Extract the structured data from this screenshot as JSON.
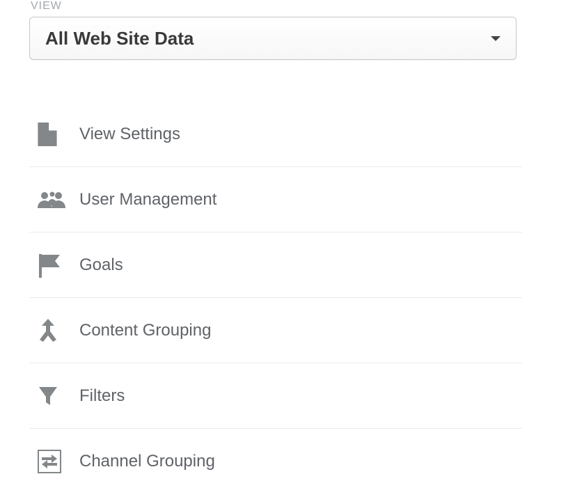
{
  "section_label": "VIEW",
  "dropdown": {
    "selected": "All Web Site Data"
  },
  "menu": {
    "items": [
      {
        "icon": "document-icon",
        "label": "View Settings"
      },
      {
        "icon": "users-icon",
        "label": "User Management"
      },
      {
        "icon": "flag-icon",
        "label": "Goals"
      },
      {
        "icon": "merge-icon",
        "label": "Content Grouping"
      },
      {
        "icon": "funnel-icon",
        "label": "Filters"
      },
      {
        "icon": "swap-icon",
        "label": "Channel Grouping"
      }
    ]
  }
}
